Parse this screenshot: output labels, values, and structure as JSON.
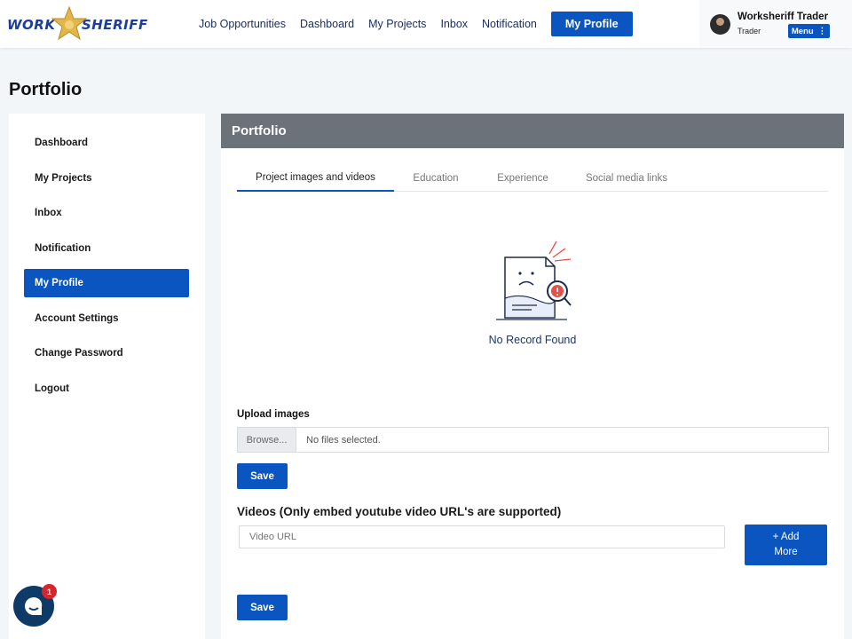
{
  "header": {
    "logo": {
      "left": "WORK",
      "right": "SHERIFF"
    },
    "nav": [
      {
        "label": "Job Opportunities"
      },
      {
        "label": "Dashboard"
      },
      {
        "label": "My Projects"
      },
      {
        "label": "Inbox"
      },
      {
        "label": "Notification"
      },
      {
        "label": "My Profile",
        "active": true
      }
    ],
    "user": {
      "name": "Worksheriff Trader",
      "role": "Trader",
      "menu_label": "Menu"
    }
  },
  "page": {
    "title": "Portfolio"
  },
  "sidebar": {
    "items": [
      {
        "label": "Dashboard"
      },
      {
        "label": "My Projects"
      },
      {
        "label": "Inbox"
      },
      {
        "label": "Notification"
      },
      {
        "label": "My Profile",
        "active": true
      },
      {
        "label": "Account Settings"
      },
      {
        "label": "Change Password"
      },
      {
        "label": "Logout"
      }
    ]
  },
  "panel": {
    "title": "Portfolio",
    "tabs": [
      {
        "label": "Project images and videos",
        "active": true
      },
      {
        "label": "Education"
      },
      {
        "label": "Experience"
      },
      {
        "label": "Social media links"
      }
    ],
    "empty_state": "No Record Found",
    "upload": {
      "label": "Upload images",
      "browse_label": "Browse...",
      "status": "No files selected.",
      "save_label": "Save"
    },
    "videos": {
      "title": "Videos (Only embed youtube video URL's are supported)",
      "placeholder": "Video URL",
      "add_more_line1": "+ Add",
      "add_more_line2": "More",
      "save_label": "Save"
    }
  },
  "chat": {
    "badge_count": "1"
  },
  "colors": {
    "primary": "#0a55c0",
    "panel_header": "#6c7279",
    "page_bg": "#f3f6f9",
    "badge": "#d5262d"
  }
}
